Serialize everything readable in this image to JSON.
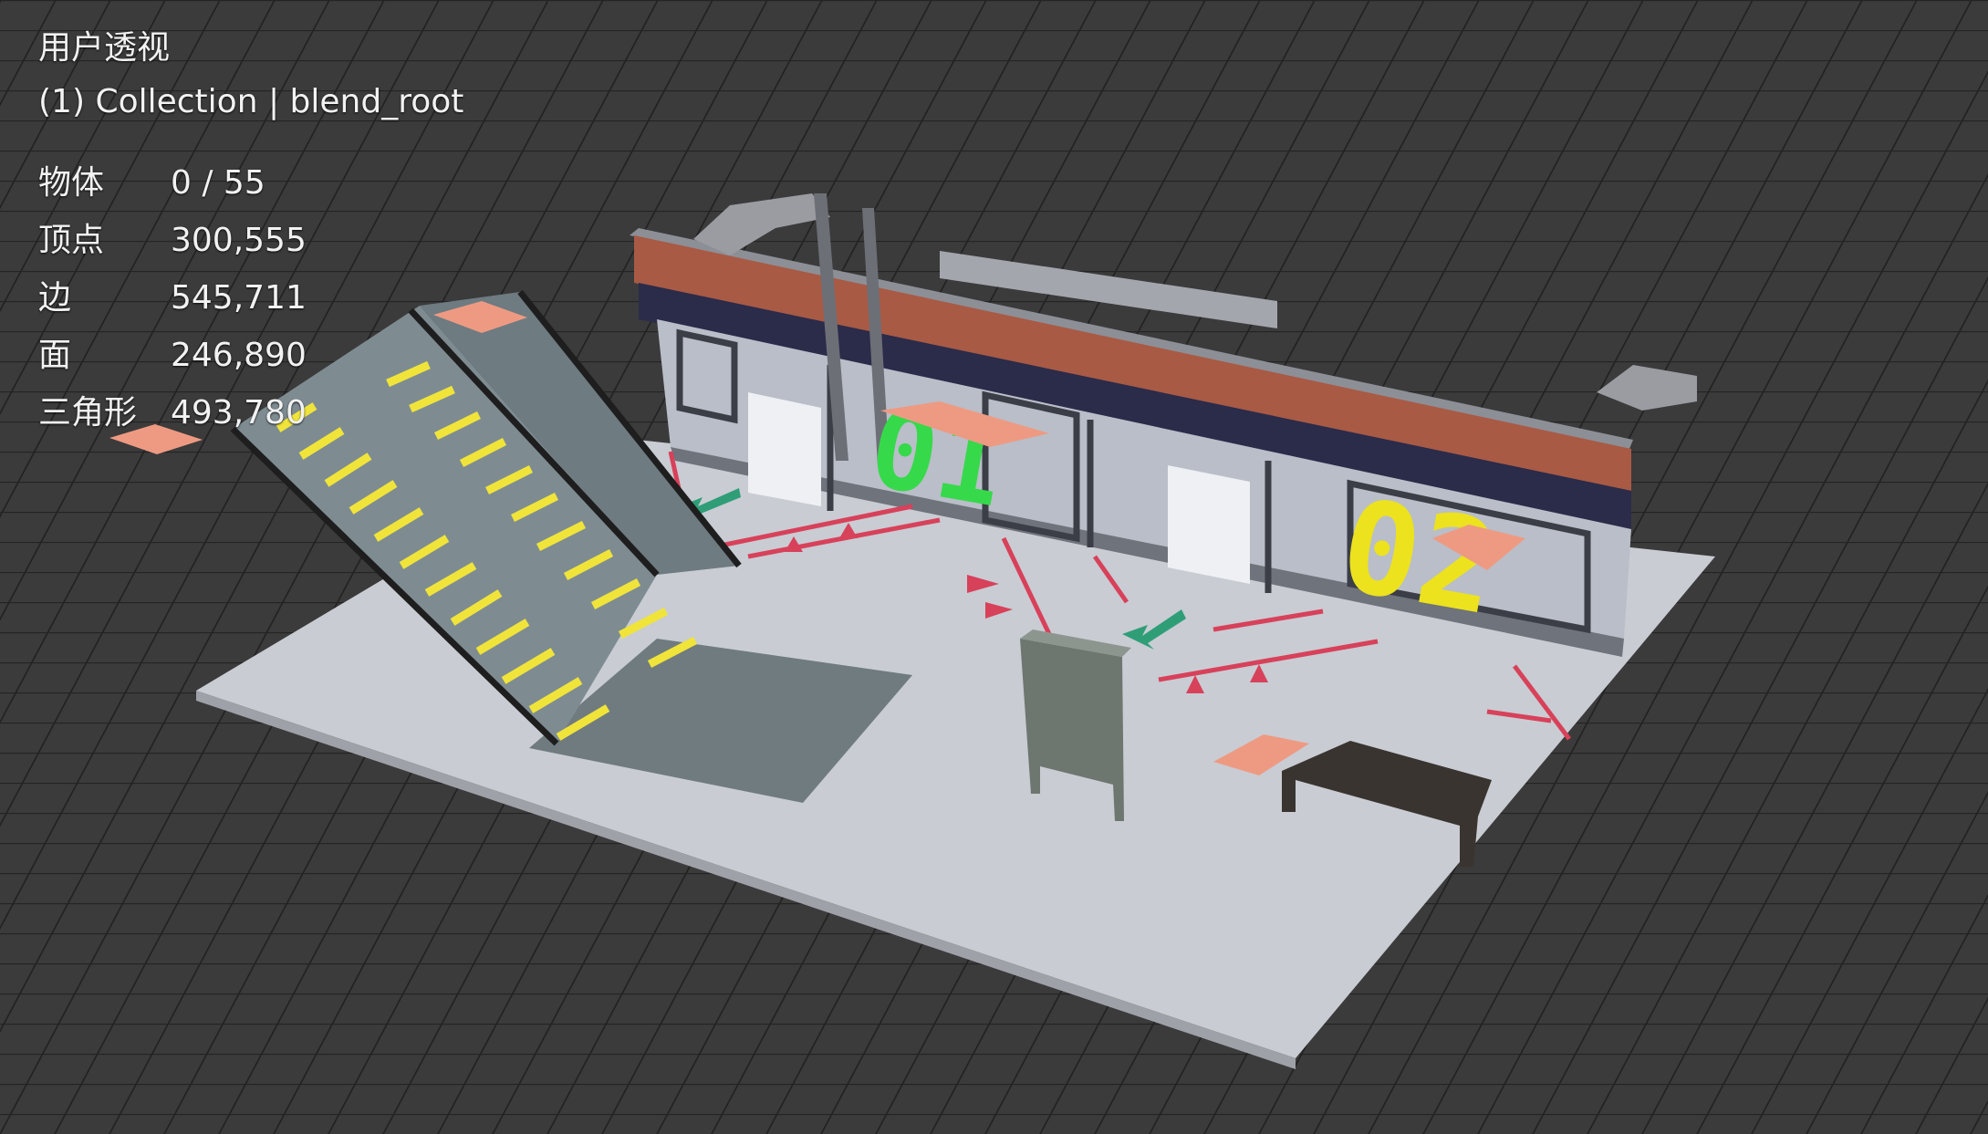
{
  "viewport": {
    "view_name": "用户透视",
    "collection_label": "(1) Collection | blend_root"
  },
  "stats": [
    {
      "label": "物体",
      "value": "0 / 55"
    },
    {
      "label": "顶点",
      "value": "300,555"
    },
    {
      "label": "边",
      "value": "545,711"
    },
    {
      "label": "面",
      "value": "246,890"
    },
    {
      "label": "三角形",
      "value": "493,780"
    }
  ],
  "scene": {
    "platform_numbers": [
      "01",
      "02"
    ],
    "colors": {
      "background": "#3b3b3b",
      "grid": "#262626",
      "floor": "#c9ccd3",
      "wall_band": "#a85a45",
      "wall_dark": "#2b2b4a",
      "stair_tread": "#f0e43a",
      "number_01": "#36d94a",
      "number_02": "#ece21e",
      "markings": "#d8415a",
      "arrow_green": "#2f9e77",
      "pad": "#ee9a82"
    }
  }
}
